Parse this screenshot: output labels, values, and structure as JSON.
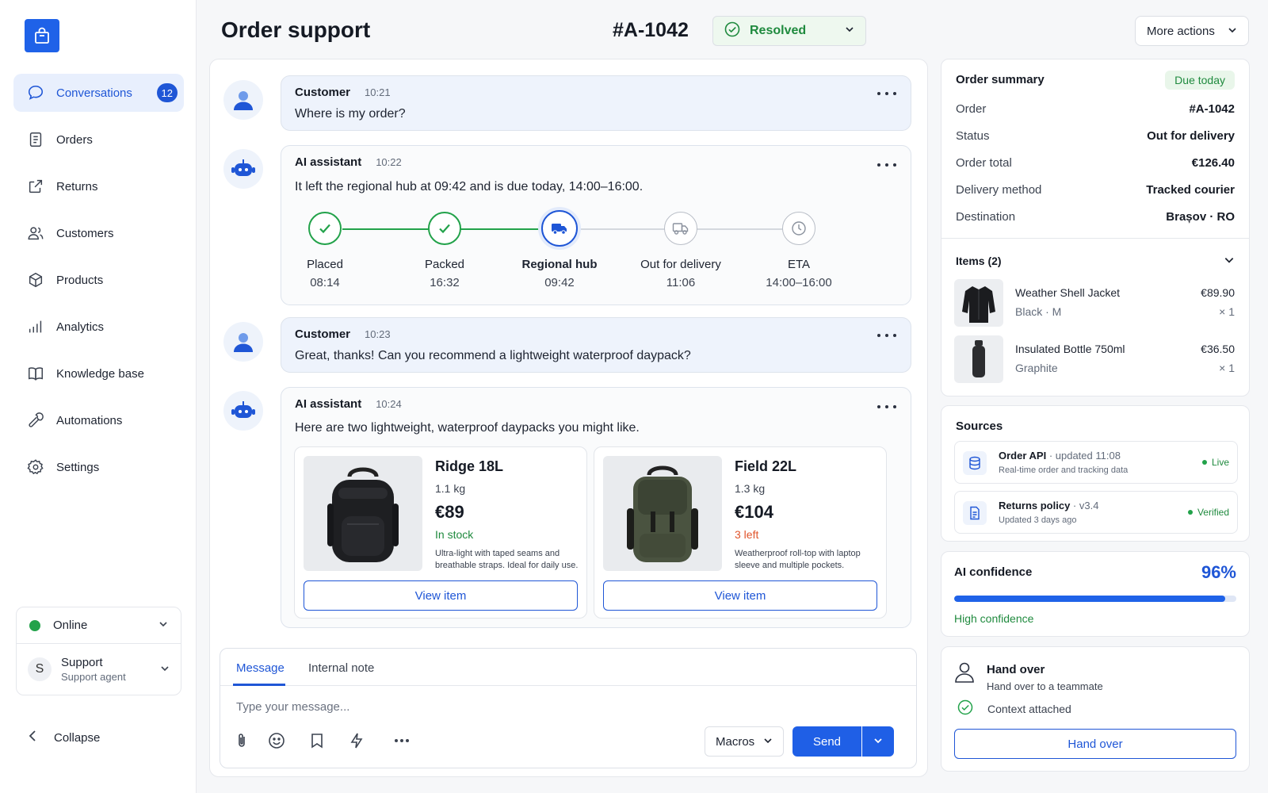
{
  "sidebar": {
    "items": [
      {
        "label": "Conversations",
        "icon": "chat-bubble-icon",
        "badge": "12"
      },
      {
        "label": "Orders",
        "icon": "clipboard-icon"
      },
      {
        "label": "Returns",
        "icon": "return-arrow-icon"
      },
      {
        "label": "Customers",
        "icon": "users-icon"
      },
      {
        "label": "Products",
        "icon": "box-icon"
      },
      {
        "label": "Analytics",
        "icon": "bar-chart-icon"
      },
      {
        "label": "Knowledge base",
        "icon": "book-icon"
      },
      {
        "label": "Automations",
        "icon": "wrench-icon"
      },
      {
        "label": "Settings",
        "icon": "gear-icon"
      }
    ],
    "status": "Online",
    "agent": {
      "initial": "S",
      "name": "Support",
      "role": "Support agent"
    },
    "collapse": "Collapse"
  },
  "header": {
    "title": "Order support",
    "order_id": "#A-1042",
    "status": "Resolved",
    "more_actions": "More actions"
  },
  "conversation": {
    "messages": [
      {
        "author": "Customer",
        "time": "10:21",
        "text": "Where is my order?"
      },
      {
        "author": "AI assistant",
        "time": "10:22",
        "text": "It left the regional hub at 09:42 and is due today, 14:00–16:00."
      },
      {
        "author": "Customer",
        "time": "10:23",
        "text": "Great, thanks! Can you recommend a lightweight waterproof daypack?"
      },
      {
        "author": "AI assistant",
        "time": "10:24",
        "text": "Here are two lightweight, waterproof daypacks you might like."
      }
    ],
    "tracking": [
      {
        "label": "Placed",
        "time": "08:14",
        "state": "done"
      },
      {
        "label": "Packed",
        "time": "16:32",
        "state": "done"
      },
      {
        "label": "Regional hub",
        "time": "09:42",
        "state": "current"
      },
      {
        "label": "Out for delivery",
        "time": "11:06",
        "state": "pending"
      },
      {
        "label": "ETA",
        "time": "14:00–16:00",
        "state": "pending"
      }
    ],
    "products": [
      {
        "name": "Ridge 18L",
        "weight": "1.1 kg",
        "price": "€89",
        "stock": "In stock",
        "stock_color": "#1f8a3e",
        "desc": "Ultra-light with taped seams and breathable straps. Ideal for daily use.",
        "button": "View item"
      },
      {
        "name": "Field 22L",
        "weight": "1.3 kg",
        "price": "€104",
        "stock": "3 left",
        "stock_color": "#e0542b",
        "desc": "Weatherproof roll-top with laptop sleeve and multiple pockets.",
        "button": "View item"
      }
    ]
  },
  "composer": {
    "tab_message": "Message",
    "tab_note": "Internal note",
    "placeholder": "Type your message...",
    "macros": "Macros",
    "send": "Send"
  },
  "order_summary": {
    "title": "Order summary",
    "due": "Due today",
    "rows": [
      {
        "k": "Order",
        "v": "#A-1042"
      },
      {
        "k": "Status",
        "v": "Out for delivery"
      },
      {
        "k": "Order total",
        "v": "€126.40"
      },
      {
        "k": "Delivery method",
        "v": "Tracked courier"
      },
      {
        "k": "Destination",
        "v": "Brașov · RO"
      }
    ],
    "items_title": "Items (2)",
    "items": [
      {
        "name": "Weather Shell Jacket",
        "variant": "Black · M",
        "price": "€89.90",
        "qty": "× 1"
      },
      {
        "name": "Insulated Bottle 750ml",
        "variant": "Graphite",
        "price": "€36.50",
        "qty": "× 1"
      }
    ]
  },
  "sources": {
    "title": "Sources",
    "items": [
      {
        "name": "Order API",
        "meta": " · updated 11:08",
        "sub": "Real-time order and tracking data",
        "status": "Live"
      },
      {
        "name": "Returns policy",
        "meta": " · v3.4",
        "sub": "Updated 3 days ago",
        "status": "Verified"
      }
    ]
  },
  "confidence": {
    "title": "AI confidence",
    "value": "96%",
    "fraction": 0.96,
    "label": "High confidence"
  },
  "handover": {
    "title": "Hand over",
    "subtitle": "Hand over to a teammate",
    "context": "Context attached",
    "button": "Hand over"
  },
  "colors": {
    "accent": "#1f56d6",
    "success": "#1f8a3e",
    "warning": "#e0542b"
  }
}
